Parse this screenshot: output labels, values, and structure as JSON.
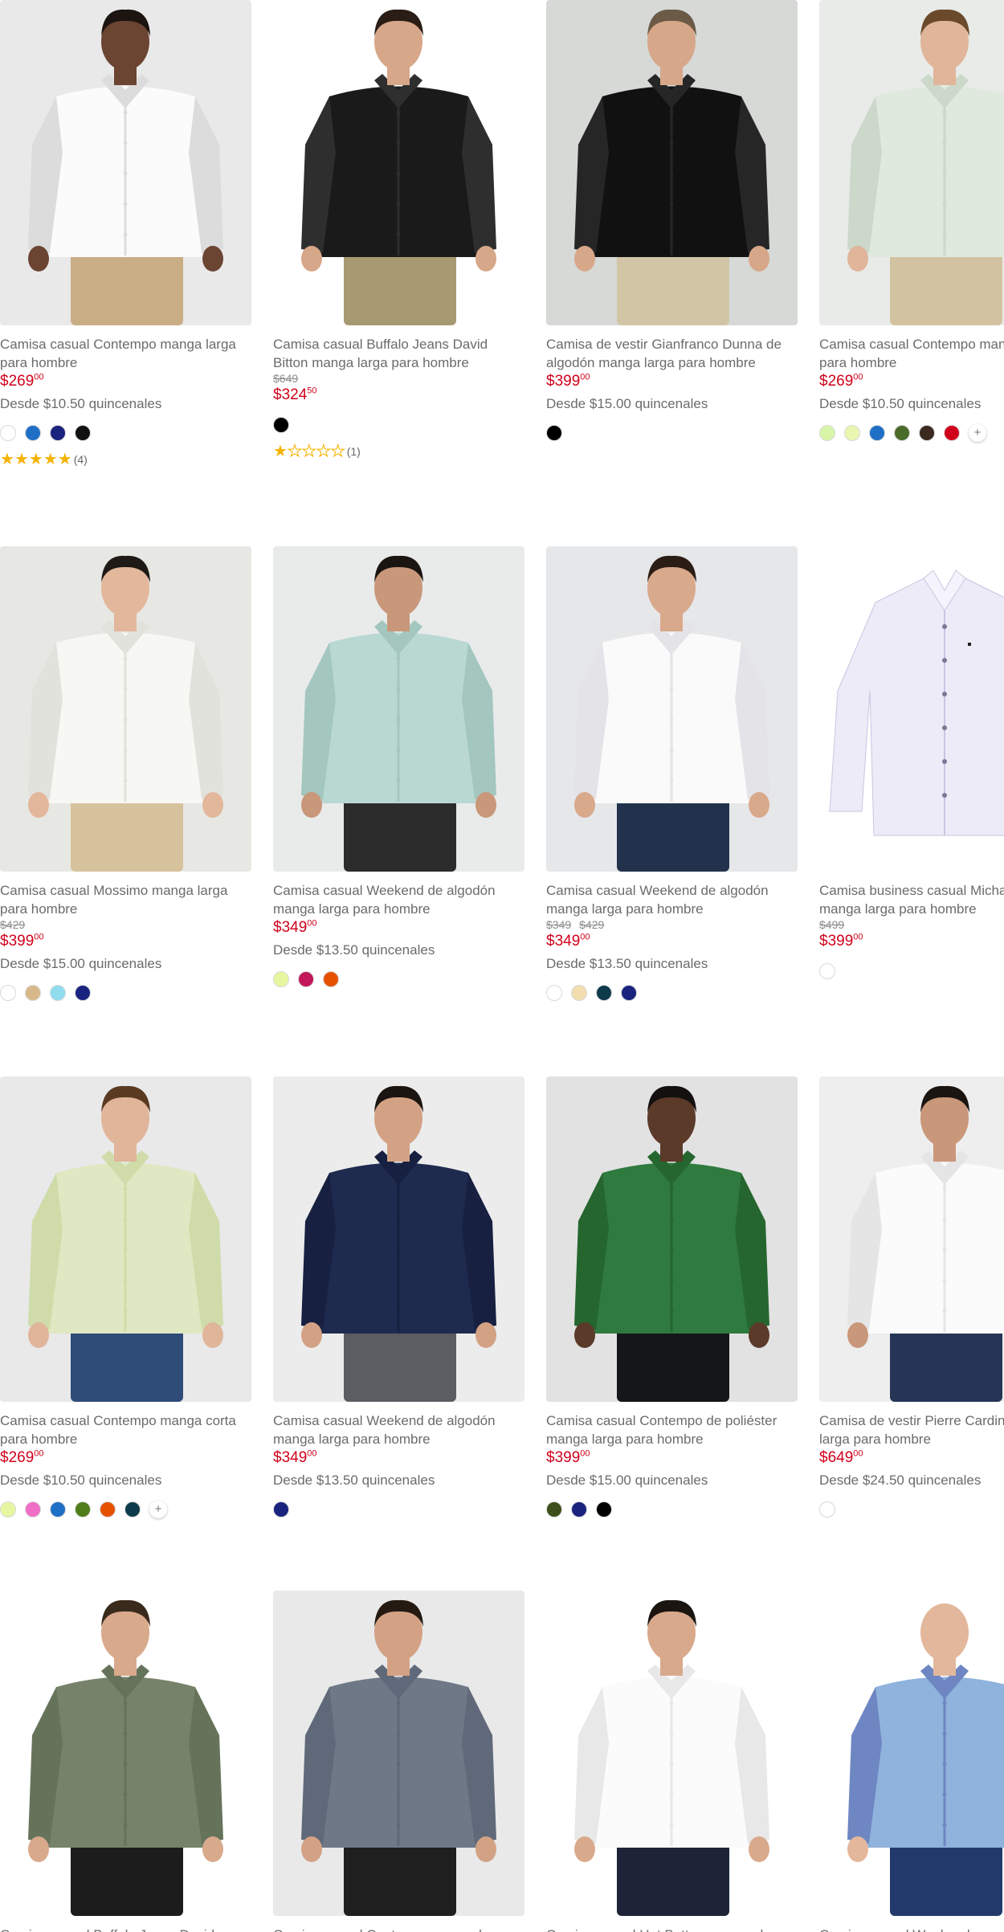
{
  "products": [
    {
      "title": "Camisa casual Contempo manga larga para hombre",
      "price": "$269",
      "cents": "00",
      "old_prices": [],
      "installments": "Desde $10.50 quincenales",
      "colors": [
        "#ffffff",
        "#1f6fc6",
        "#1a237e",
        "#111111"
      ],
      "more": "",
      "rating": {
        "stars": 5,
        "count": "(4)"
      },
      "image": "white-shirt-model"
    },
    {
      "title": "Camisa casual Buffalo Jeans David Bitton manga larga para hombre",
      "price": "$324",
      "cents": "50",
      "old_prices": [
        "$649"
      ],
      "installments": "",
      "colors": [
        "#000000"
      ],
      "more": "",
      "rating": {
        "stars": 1,
        "count": "(1)"
      },
      "image": "black-denim-shirt-model"
    },
    {
      "title": "Camisa de vestir Gianfranco Dunna de algodón manga larga para hombre",
      "price": "$399",
      "cents": "00",
      "old_prices": [],
      "installments": "Desde $15.00 quincenales",
      "colors": [
        "#000000"
      ],
      "more": "",
      "rating": null,
      "image": "black-dress-shirt-model"
    },
    {
      "title": "Camisa casual Contempo manga larga para hombre",
      "price": "$269",
      "cents": "00",
      "old_prices": [],
      "installments": "Desde $10.50 quincenales",
      "colors": [
        "#d9f5a8",
        "#e8f7b0",
        "#1f6fc6",
        "#4a6b2a",
        "#3b2a1f",
        "#d0021b"
      ],
      "more": "+",
      "rating": null,
      "image": "mint-shirt-model"
    },
    {
      "title": "Camisa casual Mossimo manga larga para hombre",
      "price": "$399",
      "cents": "00",
      "old_prices": [
        "$429"
      ],
      "installments": "Desde $15.00 quincenales",
      "colors": [
        "#ffffff",
        "#d8b88a",
        "#8fdcef",
        "#1a237e"
      ],
      "more": "",
      "rating": null,
      "image": "white-mandarin-shirt-model"
    },
    {
      "title": "Camisa casual Weekend de algodón manga larga para hombre",
      "price": "$349",
      "cents": "00",
      "old_prices": [],
      "installments": "Desde $13.50 quincenales",
      "colors": [
        "#e4f7a0",
        "#c2185b",
        "#e65100"
      ],
      "more": "",
      "rating": null,
      "image": "mint-cotton-shirt-model"
    },
    {
      "title": "Camisa casual Weekend de algodón manga larga para hombre",
      "price": "$349",
      "cents": "00",
      "old_prices": [
        "$349",
        "$429"
      ],
      "installments": "Desde $13.50 quincenales",
      "colors": [
        "#ffffff",
        "#f1ddb0",
        "#0d3b4c",
        "#1a237e"
      ],
      "more": "",
      "rating": null,
      "image": "white-cotton-shirt-model"
    },
    {
      "title": "Camisa business casual Michael Kors manga larga para hombre",
      "price": "$399",
      "cents": "00",
      "old_prices": [
        "$499"
      ],
      "installments": "",
      "colors": [
        "#ffffff"
      ],
      "more": "",
      "rating": null,
      "image": "lavender-shirt-product"
    },
    {
      "title": "Camisa casual Contempo manga corta para hombre",
      "price": "$269",
      "cents": "00",
      "old_prices": [],
      "installments": "Desde $10.50 quincenales",
      "colors": [
        "#e4f7a0",
        "#f06ec6",
        "#1f6fc6",
        "#4e7d1a",
        "#e65100",
        "#0d3b4c"
      ],
      "more": "+",
      "rating": null,
      "image": "lime-short-sleeve-model"
    },
    {
      "title": "Camisa casual Weekend de algodón manga larga para hombre",
      "price": "$349",
      "cents": "00",
      "old_prices": [],
      "installments": "Desde $13.50 quincenales",
      "colors": [
        "#1a237e"
      ],
      "more": "",
      "rating": null,
      "image": "navy-shirt-model"
    },
    {
      "title": "Camisa casual Contempo de poliéster manga larga para hombre",
      "price": "$399",
      "cents": "00",
      "old_prices": [],
      "installments": "Desde $15.00 quincenales",
      "colors": [
        "#3d4f1a",
        "#1a237e",
        "#000000"
      ],
      "more": "",
      "rating": null,
      "image": "green-shirt-model"
    },
    {
      "title": "Camisa de vestir Pierre Cardin manga larga para hombre",
      "price": "$649",
      "cents": "00",
      "old_prices": [],
      "installments": "Desde $24.50 quincenales",
      "colors": [
        "#ffffff"
      ],
      "more": "",
      "rating": null,
      "image": "white-dress-shirt-model"
    },
    {
      "title": "Camisa casual Buffalo Jeans David Bitton",
      "price": "",
      "cents": "",
      "old_prices": [],
      "installments": "",
      "colors": [],
      "more": "",
      "rating": null,
      "image": "olive-shirt-model"
    },
    {
      "title": "Camisa casual Contempo manga larga",
      "price": "",
      "cents": "",
      "old_prices": [],
      "installments": "",
      "colors": [],
      "more": "",
      "rating": null,
      "image": "grey-shirt-model"
    },
    {
      "title": "Camisa casual Hot Buttons manga larga",
      "price": "",
      "cents": "",
      "old_prices": [],
      "installments": "",
      "colors": [],
      "more": "",
      "rating": null,
      "image": "white-oxford-shirt-model"
    },
    {
      "title": "Camisa casual Weekend",
      "price": "",
      "cents": "",
      "old_prices": [],
      "installments": "",
      "colors": [],
      "more": "",
      "rating": null,
      "image": "plaid-short-sleeve-model"
    }
  ],
  "theme": {
    "price_color": "#d0021b",
    "star_color": "#f5b301"
  }
}
